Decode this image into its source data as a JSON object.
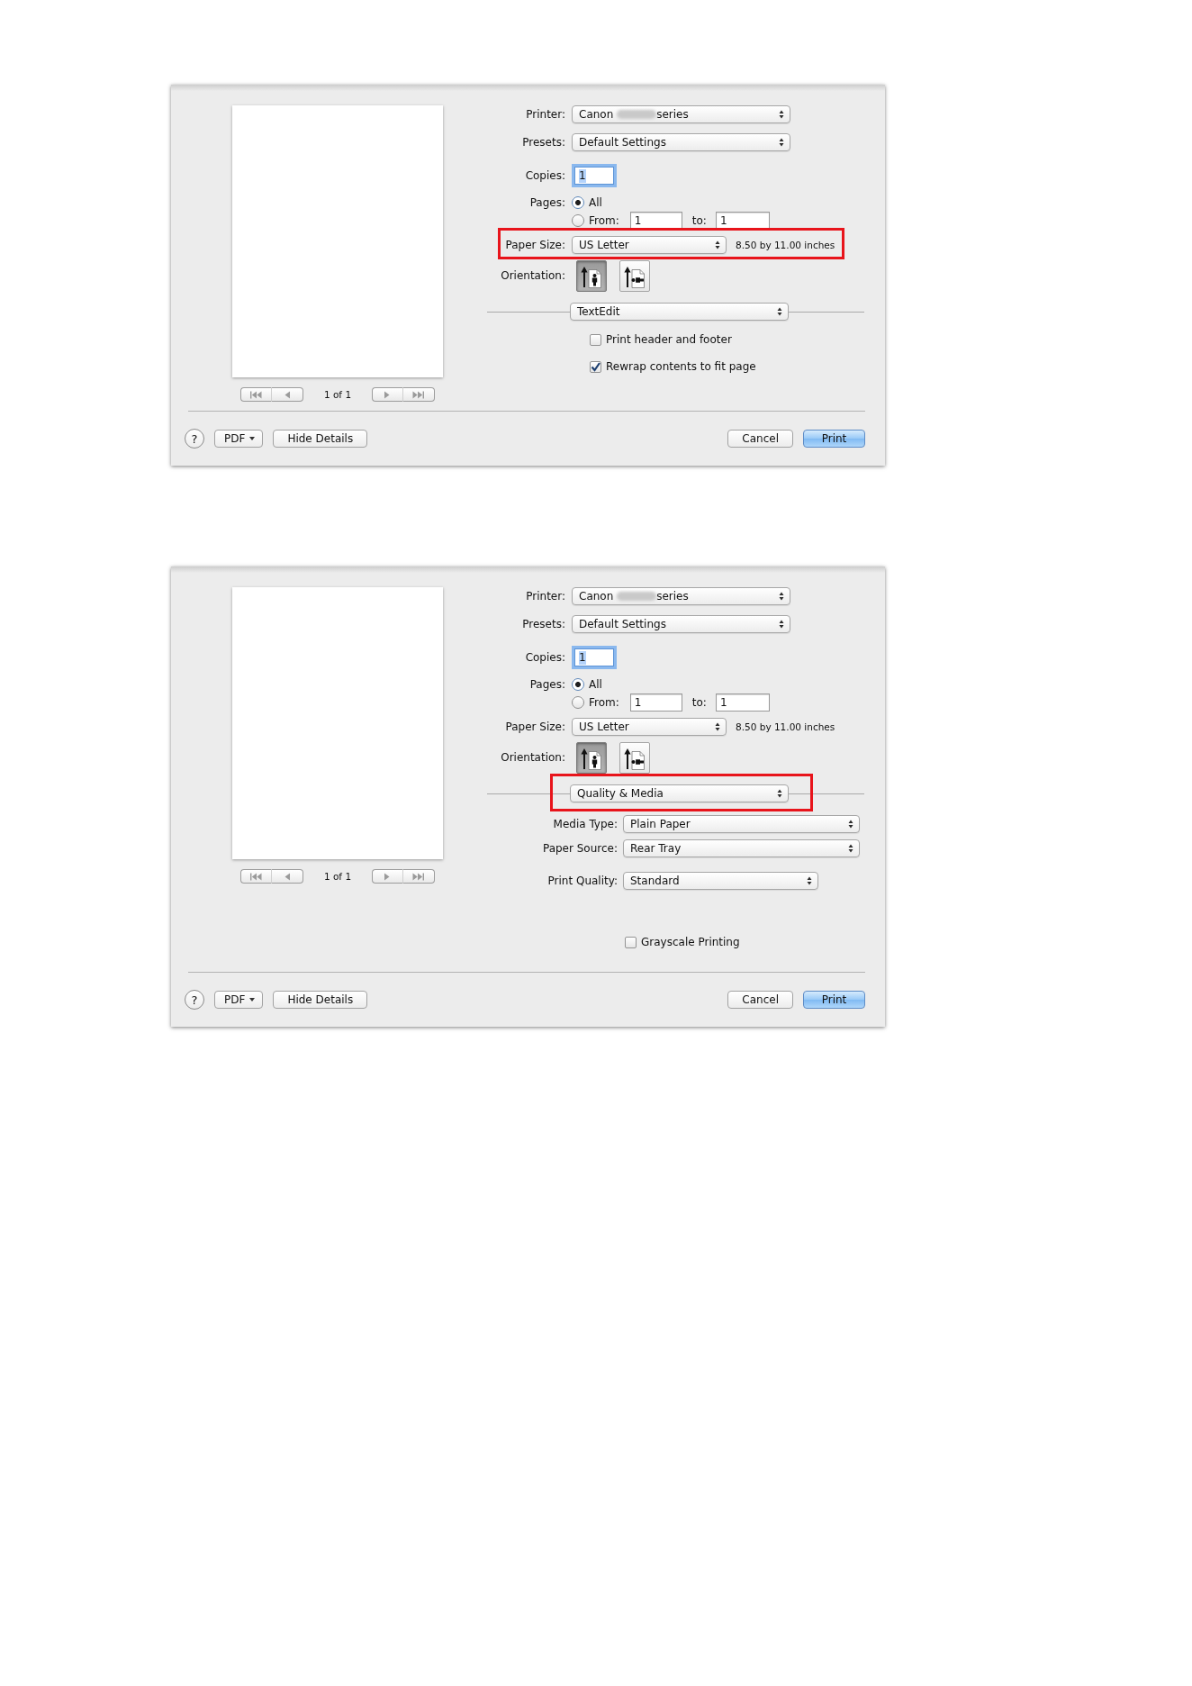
{
  "dialogs": [
    {
      "preview": {
        "counter": "1 of 1",
        "nav_disabled": true
      },
      "printer": {
        "label": "Printer:",
        "value": [
          "Canon",
          "series"
        ],
        "redacted": true
      },
      "presets": {
        "label": "Presets:",
        "value": "Default Settings"
      },
      "copies": {
        "label": "Copies:",
        "value": "1",
        "focused": true
      },
      "pages": {
        "label": "Pages:",
        "options": [
          {
            "kind": "all",
            "label": "All",
            "selected": true
          },
          {
            "kind": "range",
            "label": "From:",
            "selected": false,
            "from": "1",
            "to_label": "to:",
            "to": "1"
          }
        ]
      },
      "paper_size": {
        "label": "Paper Size:",
        "value": "US Letter",
        "dimensions": "8.50 by 11.00 inches",
        "highlighted": true
      },
      "orientation": {
        "label": "Orientation:",
        "options": [
          {
            "kind": "portrait",
            "selected": true
          },
          {
            "kind": "landscape",
            "selected": false
          }
        ]
      },
      "panel_menu": {
        "value": "TextEdit",
        "highlighted": false
      },
      "panel_items": [
        {
          "kind": "checkbox",
          "label": "Print header and footer",
          "checked": false
        },
        {
          "kind": "checkbox",
          "label": "Rewrap contents to fit page",
          "checked": true
        }
      ],
      "footer": {
        "left": [
          {
            "kind": "help",
            "label": "?"
          },
          {
            "kind": "menu",
            "label": "PDF"
          },
          {
            "kind": "details",
            "label": "Hide Details"
          }
        ],
        "right": [
          {
            "kind": "cancel",
            "label": "Cancel"
          },
          {
            "kind": "confirm",
            "label": "Print"
          }
        ]
      }
    },
    {
      "preview": {
        "counter": "1 of 1",
        "nav_disabled": true
      },
      "printer": {
        "label": "Printer:",
        "value": [
          "Canon",
          "series"
        ],
        "redacted": true
      },
      "presets": {
        "label": "Presets:",
        "value": "Default Settings"
      },
      "copies": {
        "label": "Copies:",
        "value": "1",
        "focused": true
      },
      "pages": {
        "label": "Pages:",
        "options": [
          {
            "kind": "all",
            "label": "All",
            "selected": true
          },
          {
            "kind": "range",
            "label": "From:",
            "selected": false,
            "from": "1",
            "to_label": "to:",
            "to": "1"
          }
        ]
      },
      "paper_size": {
        "label": "Paper Size:",
        "value": "US Letter",
        "dimensions": "8.50 by 11.00 inches",
        "highlighted": false
      },
      "orientation": {
        "label": "Orientation:",
        "options": [
          {
            "kind": "portrait",
            "selected": true
          },
          {
            "kind": "landscape",
            "selected": false
          }
        ]
      },
      "panel_menu": {
        "value": "Quality & Media",
        "highlighted": true
      },
      "panel_items": [
        {
          "kind": "popup",
          "label": "Media Type:",
          "value": "Plain Paper"
        },
        {
          "kind": "popup",
          "label": "Paper Source:",
          "value": "Rear Tray"
        },
        {
          "kind": "narrowpopup",
          "label": "Print Quality:",
          "value": "Standard"
        },
        {
          "kind": "checkbox",
          "label": "Grayscale Printing",
          "checked": false
        }
      ],
      "footer": {
        "left": [
          {
            "kind": "help",
            "label": "?"
          },
          {
            "kind": "menu",
            "label": "PDF"
          },
          {
            "kind": "details",
            "label": "Hide Details"
          }
        ],
        "right": [
          {
            "kind": "cancel",
            "label": "Cancel"
          },
          {
            "kind": "confirm",
            "label": "Print"
          }
        ]
      }
    }
  ]
}
